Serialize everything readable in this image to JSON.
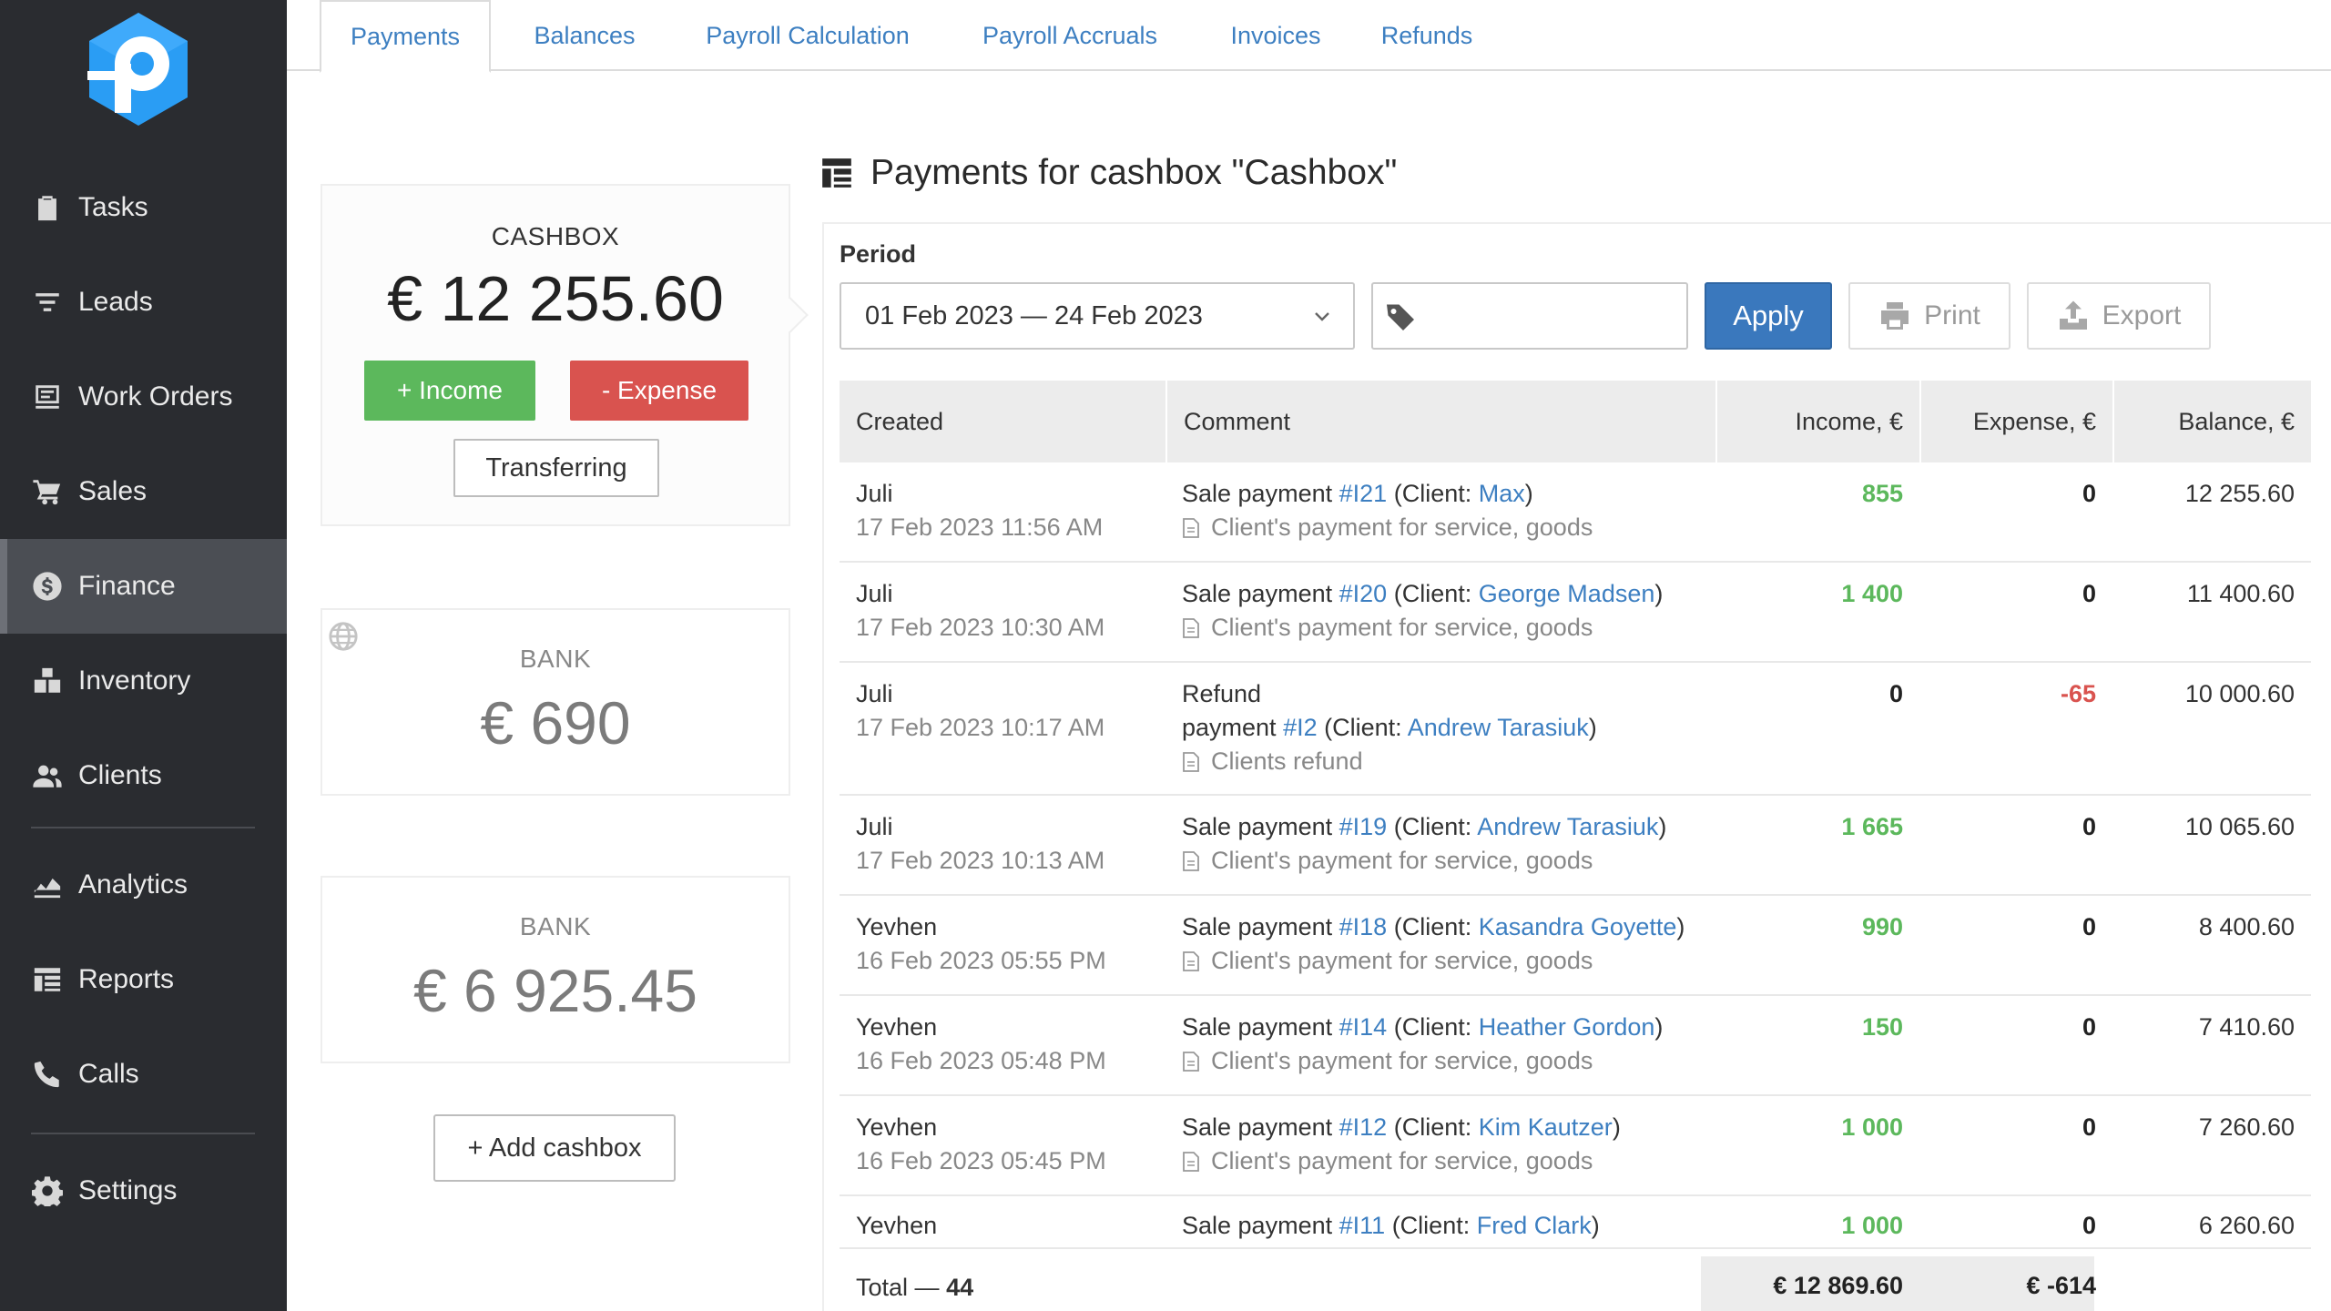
{
  "sidebar": {
    "items": [
      {
        "label": "Tasks",
        "icon": "clipboard-icon"
      },
      {
        "label": "Leads",
        "icon": "filter-icon"
      },
      {
        "label": "Work Orders",
        "icon": "work-order-icon"
      },
      {
        "label": "Sales",
        "icon": "cart-icon"
      },
      {
        "label": "Finance",
        "icon": "dollar-icon",
        "active": true
      },
      {
        "label": "Inventory",
        "icon": "boxes-icon"
      },
      {
        "label": "Clients",
        "icon": "users-icon"
      },
      {
        "label": "Analytics",
        "icon": "chart-icon"
      },
      {
        "label": "Reports",
        "icon": "reports-icon"
      },
      {
        "label": "Calls",
        "icon": "phone-icon"
      },
      {
        "label": "Settings",
        "icon": "gear-icon"
      }
    ]
  },
  "tabs": [
    "Payments",
    "Balances",
    "Payroll Calculation",
    "Payroll Accruals",
    "Invoices",
    "Refunds"
  ],
  "cashboxes": {
    "main": {
      "title": "CASHBOX",
      "amount": "€ 12 255.60",
      "income_label": "+ Income",
      "expense_label": "- Expense",
      "transfer_label": "Transferring"
    },
    "bank1": {
      "title": "BANK",
      "amount": "€ 690"
    },
    "bank2": {
      "title": "BANK",
      "amount": "€ 6 925.45"
    },
    "add_label": "+ Add cashbox"
  },
  "content": {
    "title": "Payments for cashbox \"Cashbox\"",
    "period_label": "Period",
    "period_value": "01 Feb 2023 — 24 Feb 2023",
    "apply_label": "Apply",
    "print_label": "Print",
    "export_label": "Export"
  },
  "table": {
    "headers": {
      "created": "Created",
      "comment": "Comment",
      "income": "Income, €",
      "expense": "Expense, €",
      "balance": "Balance, €"
    },
    "rows": [
      {
        "user": "Juli",
        "date": "17 Feb 2023 11:56 AM",
        "prefix": "Sale payment",
        "ref": "#I21",
        "client_prefix": "(Client:",
        "client": "Max",
        "client_suffix": ")",
        "note": "Client's payment for service, goods",
        "income": "855",
        "expense": "0",
        "balance": "12 255.60"
      },
      {
        "user": "Juli",
        "date": "17 Feb 2023 10:30 AM",
        "prefix": "Sale payment",
        "ref": "#I20",
        "client_prefix": "(Client:",
        "client": "George Madsen",
        "client_suffix": ")",
        "note": "Client's payment for service, goods",
        "income": "1 400",
        "expense": "0",
        "balance": "11 400.60"
      },
      {
        "user": "Juli",
        "date": "17 Feb 2023 10:17 AM",
        "prefix_line1": "Refund",
        "prefix": "payment",
        "ref": "#I2",
        "client_prefix": "(Client:",
        "client": "Andrew Tarasiuk",
        "client_suffix": ")",
        "note": "Clients refund",
        "income": "0",
        "expense": "-65",
        "balance": "10 000.60"
      },
      {
        "user": "Juli",
        "date": "17 Feb 2023 10:13 AM",
        "prefix": "Sale payment",
        "ref": "#I19",
        "client_prefix": "(Client:",
        "client": "Andrew Tarasiuk",
        "client_suffix": ")",
        "note": "Client's payment for service, goods",
        "income": "1 665",
        "expense": "0",
        "balance": "10 065.60"
      },
      {
        "user": "Yevhen",
        "date": "16 Feb 2023 05:55 PM",
        "prefix": "Sale payment",
        "ref": "#I18",
        "client_prefix": "(Client:",
        "client": "Kasandra Goyette",
        "client_suffix": ")",
        "note": "Client's payment for service, goods",
        "income": "990",
        "expense": "0",
        "balance": "8 400.60"
      },
      {
        "user": "Yevhen",
        "date": "16 Feb 2023 05:48 PM",
        "prefix": "Sale payment",
        "ref": "#I14",
        "client_prefix": "(Client:",
        "client": "Heather Gordon",
        "client_suffix": ")",
        "note": "Client's payment for service, goods",
        "income": "150",
        "expense": "0",
        "balance": "7 410.60"
      },
      {
        "user": "Yevhen",
        "date": "16 Feb 2023 05:45 PM",
        "prefix": "Sale payment",
        "ref": "#I12",
        "client_prefix": "(Client:",
        "client": "Kim Kautzer",
        "client_suffix": ")",
        "note": "Client's payment for service, goods",
        "income": "1 000",
        "expense": "0",
        "balance": "7 260.60"
      },
      {
        "user": "Yevhen",
        "prefix": "Sale payment",
        "ref": "#I11",
        "client_prefix": "(Client:",
        "client": "Fred Clark",
        "client_suffix": ")",
        "income": "1 000",
        "expense": "0",
        "balance": "6 260.60"
      }
    ],
    "total_label": "Total —",
    "total_count": "44",
    "total_income": "€ 12 869.60",
    "total_expense": "€ -614"
  },
  "colors": {
    "sidebar_bg": "#2a2c30",
    "accent": "#3d7fc1",
    "income": "#5cb85c",
    "expense": "#d9534f",
    "apply": "#3a78bd"
  }
}
